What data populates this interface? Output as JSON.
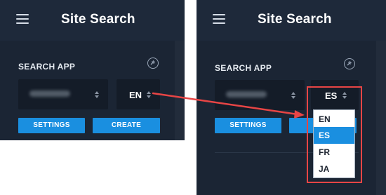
{
  "left": {
    "title": "Site Search",
    "section_label": "SEARCH APP",
    "app_select": {
      "value_hidden": true
    },
    "language_select": {
      "value": "EN"
    },
    "buttons": {
      "settings": "SETTINGS",
      "create": "CREATE"
    }
  },
  "right": {
    "title": "Site Search",
    "section_label": "SEARCH APP",
    "app_select": {
      "value_hidden": true
    },
    "language_select": {
      "value": "ES"
    },
    "buttons": {
      "settings": "SETTINGS",
      "create": "CR"
    },
    "dropdown": {
      "options": [
        "EN",
        "ES",
        "FR",
        "JA"
      ],
      "selected": "ES"
    }
  },
  "colors": {
    "panel_bg": "#1b2534",
    "header_bg": "#1e293a",
    "accent": "#1a8fe0",
    "callout": "#e84545"
  },
  "icons": [
    "menu-icon",
    "pin-icon",
    "select-arrows-icon"
  ]
}
